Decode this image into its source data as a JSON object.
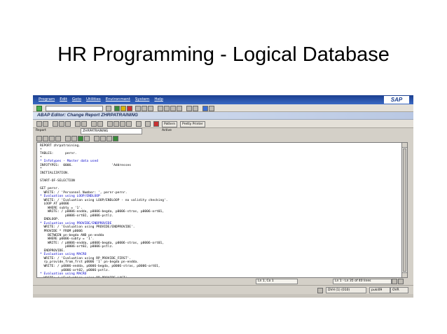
{
  "slide": {
    "title": "HR Programming - Logical Database"
  },
  "menu": {
    "items": [
      "Program",
      "Edit",
      "Goto",
      "Utilities",
      "Environment",
      "System",
      "Help"
    ],
    "logo": "SAP"
  },
  "window": {
    "title": "ABAP Editor: Change Report ZHRPATRAINING"
  },
  "toolbar": {
    "pattern_label": "Pattern",
    "pretty_printer_label": "Pretty Printer"
  },
  "report_row": {
    "report_label": "Report",
    "report_value": "ZHRPATRAINING",
    "status": "Active"
  },
  "code_lines": [
    {
      "text": "REPORT zhrpatraining.",
      "comment": false
    },
    {
      "text": "*",
      "comment": false
    },
    {
      "text": "TABLES:      pernr.",
      "comment": false
    },
    {
      "text": "*",
      "comment": false
    },
    {
      "text": "* Infotypes - Master data used",
      "comment": true
    },
    {
      "text": "INFOTYPES:  0006.                    'Addresses",
      "comment": false
    },
    {
      "text": "*",
      "comment": false
    },
    {
      "text": "INITIALIZATION.",
      "comment": false
    },
    {
      "text": "",
      "comment": false
    },
    {
      "text": "START-OF-SELECTION",
      "comment": false
    },
    {
      "text": "",
      "comment": false
    },
    {
      "text": "GET pernr.",
      "comment": false
    },
    {
      "text": "  WRITE: / 'Personnel Number: ', pernr-pernr.",
      "comment": false
    },
    {
      "text": "* Evaluation using LOOP/ENDLOOP",
      "comment": true
    },
    {
      "text": "  WRITE: / 'Evaluation using LOOP/ENDLOOP - no validity checking'.",
      "comment": false
    },
    {
      "text": "  LOOP AT p0006",
      "comment": false
    },
    {
      "text": "    WHERE subty = '1'.",
      "comment": false
    },
    {
      "text": "    WRITE: / p0006-endda, p0006-begda, p0006-stras, p0006-ort01,",
      "comment": false
    },
    {
      "text": "             p0006-ort02, p0006-pstlz.",
      "comment": false
    },
    {
      "text": "  ENDLOOP.",
      "comment": false
    },
    {
      "text": "* Evaluation using PROVIDE/ENDPROVIDE",
      "comment": true
    },
    {
      "text": "  WRITE: / 'Evaluation using PROVIDE/ENDPROVIDE'.",
      "comment": false
    },
    {
      "text": "  PROVIDE * FROM p0006",
      "comment": false
    },
    {
      "text": "    BETWEEN pn-begda AND pn-endda",
      "comment": false
    },
    {
      "text": "    WHERE p0006-subty = '1'.",
      "comment": false
    },
    {
      "text": "    WRITE: / p0006-endda, p0006-begda, p0006-stras, p0006-ort01,",
      "comment": false
    },
    {
      "text": "             p0006-ort02, p0006-pstlz.",
      "comment": false
    },
    {
      "text": "  ENDPROVIDE.",
      "comment": false
    },
    {
      "text": "* Evaluation using MACRO",
      "comment": true
    },
    {
      "text": "  WRITE: / 'Evaluation using RP_PROVIDE_FIRST'.",
      "comment": false
    },
    {
      "text": "  rp_provide_from_frst p0006 '1' pn-begda pn-endda.",
      "comment": false
    },
    {
      "text": "  WRITE: / p0006-endda, p0006-begda, p0006-stras, p0006-ort01,",
      "comment": false
    },
    {
      "text": "           p0006-ort02, p0006-pstlz.",
      "comment": false
    },
    {
      "text": "* Evaluation using MACRO",
      "comment": true
    },
    {
      "text": "  WRITE: / 'Evaluation using RP_PROVIDE_LAST'",
      "comment": false
    }
  ],
  "position": {
    "cursor": "Ln 1, Co 1",
    "lines": "Ln 1 - Ln 35 of 40 lines"
  },
  "status": {
    "system": "DVH (1) (010)",
    "server": "puki09",
    "mode": "OVR"
  }
}
